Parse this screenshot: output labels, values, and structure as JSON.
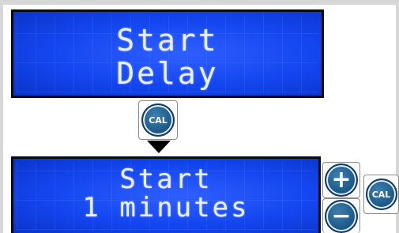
{
  "screen_top": {
    "line1": "Start",
    "line2": "Delay"
  },
  "screen_bottom": {
    "line1": "Start",
    "line2": "1 minutes"
  },
  "buttons": {
    "cal_mid": "CAL",
    "cal_right": "CAL",
    "plus": "+",
    "minus": "−"
  },
  "colors": {
    "lcd_blue": "#1446f0",
    "lcd_text": "#e9f0ff",
    "button_blue": "#1e5b8c"
  },
  "icons": {
    "plus": "plus-icon",
    "minus": "minus-icon",
    "cal": "cal-icon",
    "arrow": "arrow-down-icon"
  }
}
